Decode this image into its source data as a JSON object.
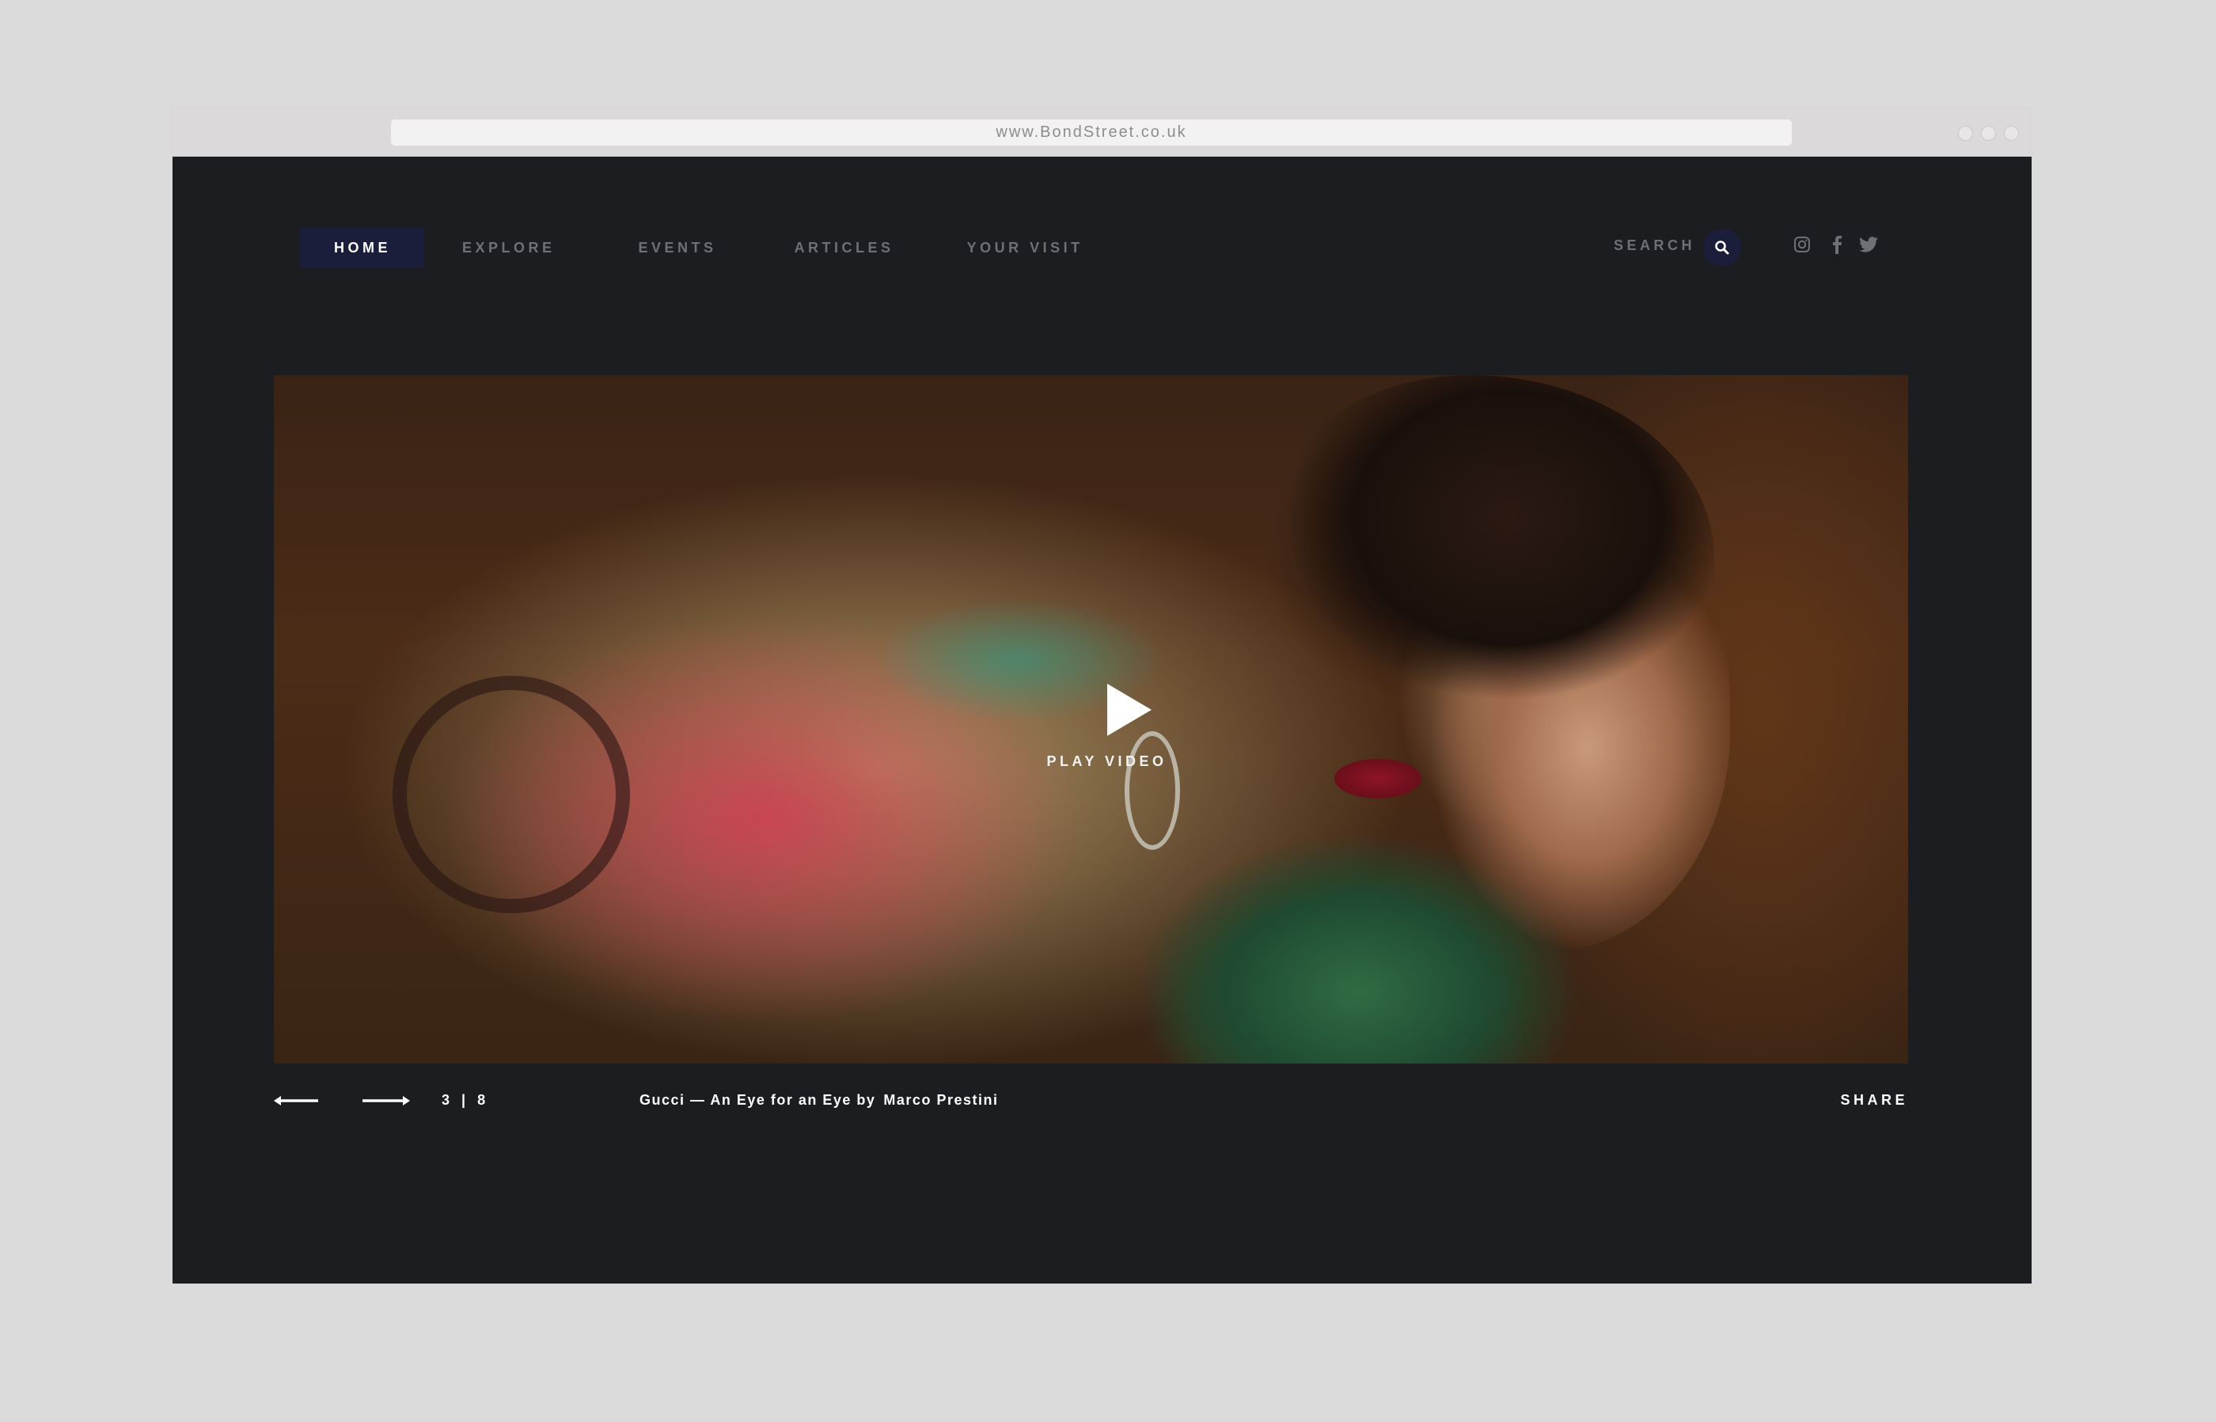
{
  "browser": {
    "url": "www.BondStreet.co.uk"
  },
  "nav": {
    "items": [
      {
        "label": "HOME",
        "active": true
      },
      {
        "label": "EXPLORE",
        "active": false
      },
      {
        "label": "EVENTS",
        "active": false
      },
      {
        "label": "ARTICLES",
        "active": false
      },
      {
        "label": "YOUR VISIT",
        "active": false
      }
    ],
    "search_label": "SEARCH",
    "social_icons": [
      "instagram-icon",
      "facebook-icon",
      "twitter-icon"
    ]
  },
  "hero": {
    "play_label": "PLAY VIDEO"
  },
  "slider": {
    "current": "3",
    "separator": "|",
    "total": "8",
    "caption_title": "Gucci — An Eye for an Eye by",
    "caption_author": "Marco Prestini",
    "share_label": "SHARE"
  },
  "colors": {
    "page_background": "#dcdbdc",
    "site_background": "#1c1d21",
    "nav_active_bg": "#1b1e3a",
    "nav_text": "#6f7075",
    "text_light": "#ffffff"
  }
}
